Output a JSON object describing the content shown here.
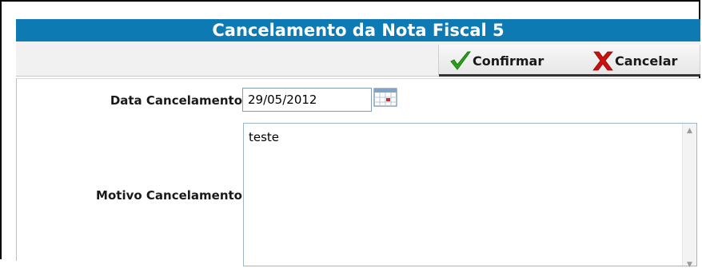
{
  "dialog": {
    "title": "Cancelamento da Nota Fiscal 5"
  },
  "toolbar": {
    "confirm_label": "Confirmar",
    "cancel_label": "Cancelar",
    "confirm_icon": "check-icon",
    "cancel_icon": "x-icon",
    "confirm_color": "#2aa01a",
    "cancel_color": "#cc1010"
  },
  "form": {
    "data_label": "Data Cancelamento",
    "data_value": "29/05/2012",
    "motivo_label": "Motivo Cancelamento",
    "motivo_value": "teste"
  },
  "colors": {
    "title_bar": "#0d7ab4",
    "title_text": "#ffffff"
  }
}
